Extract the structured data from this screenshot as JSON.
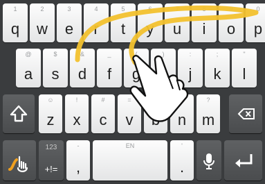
{
  "keyboard": {
    "row1": [
      {
        "label": "q",
        "hint": "1"
      },
      {
        "label": "w",
        "hint": "2"
      },
      {
        "label": "e",
        "hint": "3"
      },
      {
        "label": "r",
        "hint": "4"
      },
      {
        "label": "t",
        "hint": "5"
      },
      {
        "label": "y",
        "hint": "6"
      },
      {
        "label": "u",
        "hint": "7"
      },
      {
        "label": "i",
        "hint": "8"
      },
      {
        "label": "o",
        "hint": "9"
      },
      {
        "label": "p",
        "hint": "0"
      }
    ],
    "row2": [
      {
        "label": "a",
        "hint": "@"
      },
      {
        "label": "s",
        "hint": "$"
      },
      {
        "label": "d",
        "hint": "&"
      },
      {
        "label": "f",
        "hint": "_"
      },
      {
        "label": "g",
        "hint": "("
      },
      {
        "label": "h",
        "hint": ")"
      },
      {
        "label": "j",
        "hint": ":"
      },
      {
        "label": "k",
        "hint": ";"
      },
      {
        "label": "l",
        "hint": "\""
      }
    ],
    "row3": [
      {
        "label": "z",
        "hint": "☺"
      },
      {
        "label": "x",
        "hint": "!"
      },
      {
        "label": "c",
        "hint": "#"
      },
      {
        "label": "v",
        "hint": "="
      },
      {
        "label": "b",
        "hint": "/"
      },
      {
        "label": "n",
        "hint": "+"
      },
      {
        "label": "m",
        "hint": "?"
      }
    ],
    "symbols_key": {
      "hint": "123",
      "label": "+!="
    },
    "comma_key": {
      "label": ",",
      "hint": "-"
    },
    "space_key": {
      "language": "EN"
    },
    "period_key": {
      "label": ".",
      "hint": "'"
    }
  },
  "icons": {
    "shift": "shift-arrow-icon",
    "backspace": "backspace-icon",
    "swype": "swype-logo-icon",
    "mic": "microphone-icon",
    "enter": "enter-arrow-icon",
    "gesture": "hand-pointer-icon"
  },
  "colors": {
    "background": "#3a3c3e",
    "key_light": "#f4f4f4",
    "key_dark": "#555759",
    "swipe_trace": "#f2c12e",
    "swype_logo": "#f0a020"
  }
}
